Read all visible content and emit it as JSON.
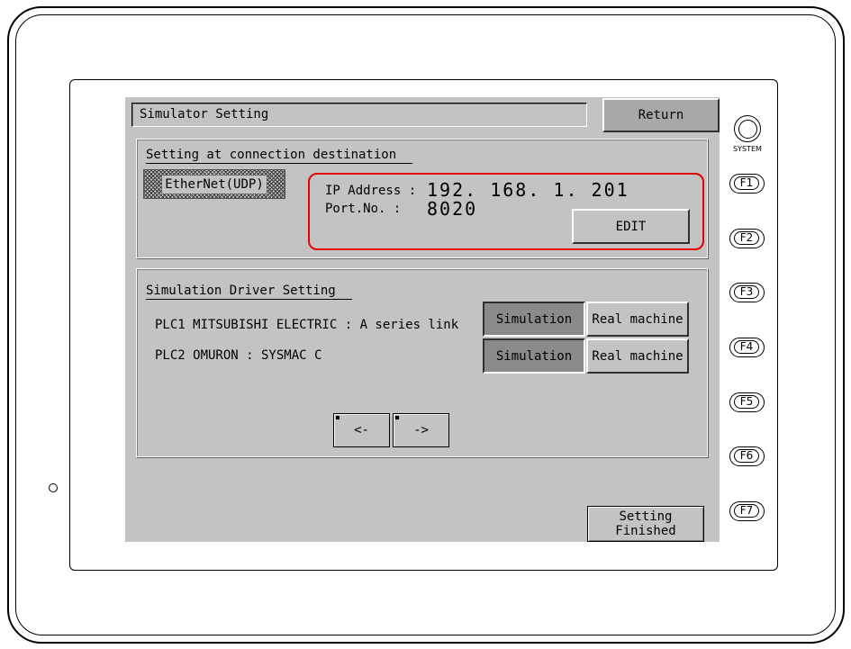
{
  "screen": {
    "title": "Simulator Setting",
    "return_label": "Return",
    "connection": {
      "section_label": "Setting at connection destination",
      "protocol": "EtherNet(UDP)",
      "ip_label": "IP Address :",
      "ip_value": "192. 168.  1. 201",
      "port_label": "Port.No.   :",
      "port_value": "8020",
      "edit_label": "EDIT"
    },
    "driver": {
      "section_label": "Simulation Driver Setting",
      "plcs": [
        {
          "name": "PLC1 MITSUBISHI ELECTRIC : A series link",
          "simulation_label": "Simulation",
          "real_label": "Real machine"
        },
        {
          "name": "PLC2 OMURON : SYSMAC C",
          "simulation_label": "Simulation",
          "real_label": "Real machine"
        }
      ],
      "prev_label": "<-",
      "next_label": "->"
    },
    "finish_line1": "Setting",
    "finish_line2": "Finished"
  },
  "hardware": {
    "system_label": "SYSTEM",
    "fkeys": [
      "F1",
      "F2",
      "F3",
      "F4",
      "F5",
      "F6",
      "F7"
    ]
  },
  "colors": {
    "screen_bg": "#c3c3c3",
    "highlight": "#e60000",
    "selected_button": "#8a8a8a"
  }
}
